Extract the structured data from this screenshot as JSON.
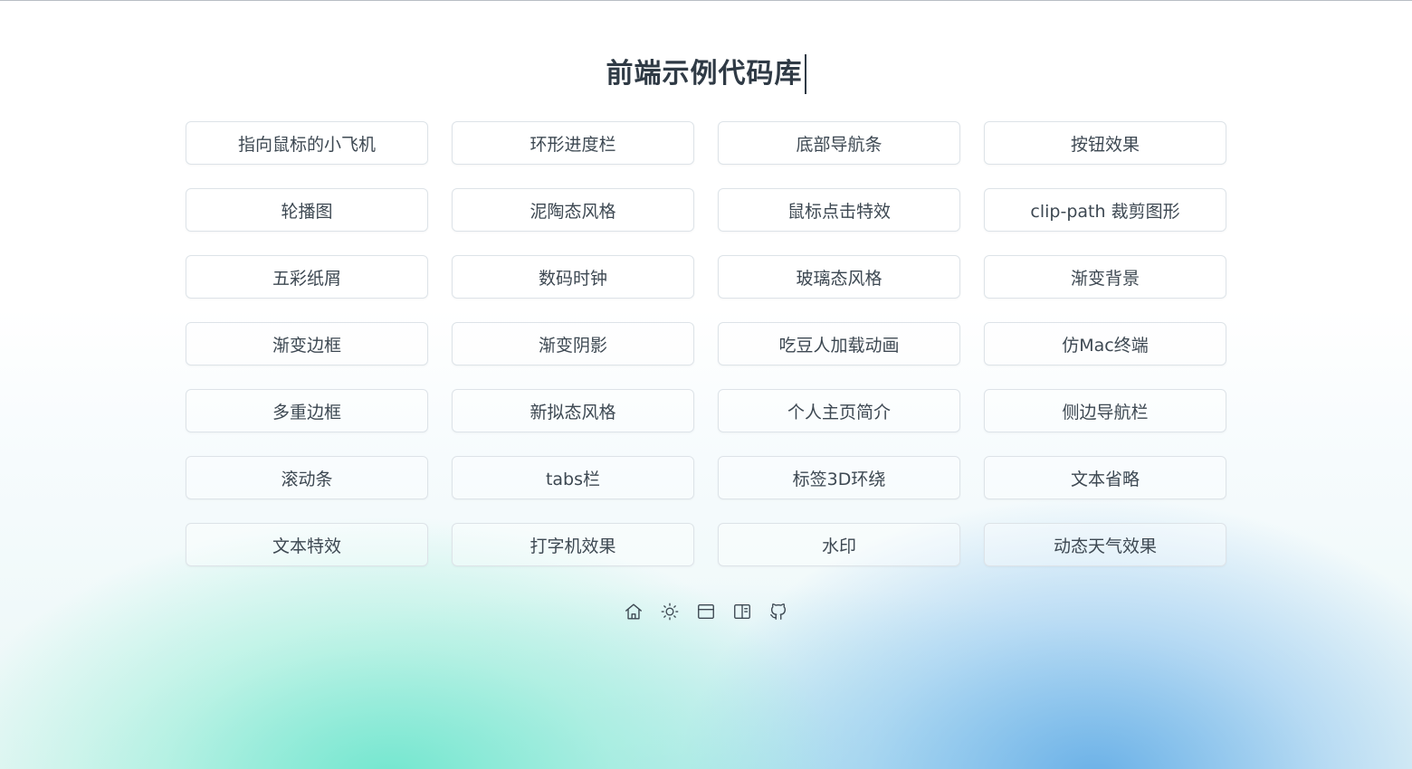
{
  "page": {
    "title": "前端示例代码库"
  },
  "examples": [
    "指向鼠标的小飞机",
    "环形进度栏",
    "底部导航条",
    "按钮效果",
    "轮播图",
    "泥陶态风格",
    "鼠标点击特效",
    "clip-path 裁剪图形",
    "五彩纸屑",
    "数码时钟",
    "玻璃态风格",
    "渐变背景",
    "渐变边框",
    "渐变阴影",
    "吃豆人加载动画",
    "仿Mac终端",
    "多重边框",
    "新拟态风格",
    "个人主页简介",
    "侧边导航栏",
    "滚动条",
    "tabs栏",
    "标签3D环绕",
    "文本省略",
    "文本特效",
    "打字机效果",
    "水印",
    "动态天气效果"
  ],
  "footer_icons": [
    "home-icon",
    "sun-icon",
    "browser-icon",
    "book-icon",
    "github-icon"
  ],
  "colors": {
    "text": "#3d4852",
    "title": "#2f3a45",
    "card_border": "#dde3e8",
    "gradient_teal": "#6ee6cd",
    "gradient_blue": "#5faae6"
  }
}
